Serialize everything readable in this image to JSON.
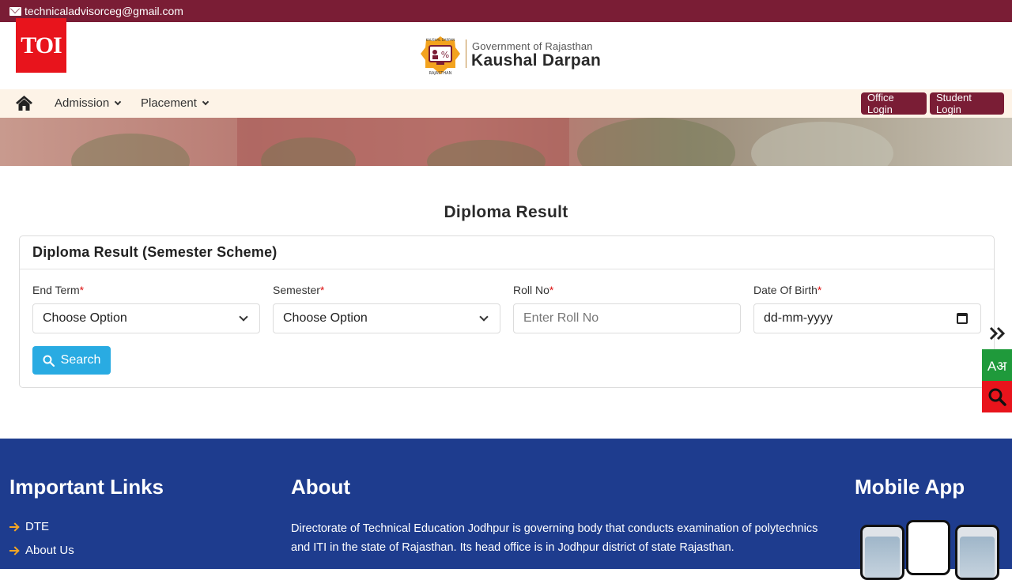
{
  "topbar": {
    "email": "technicaladvisorceg@gmail.com",
    "email_icon": "envelope-icon"
  },
  "watermark": {
    "text": "TOI"
  },
  "brand": {
    "logo_icon": "kaushal-darpan-emblem-icon",
    "logo_top_text": "KAUSHAL DARPAN",
    "logo_bottom_text": "RAJASTHAN",
    "government_text": "Government of Rajasthan",
    "title": "Kaushal Darpan"
  },
  "nav": {
    "home_icon": "home-icon",
    "items": [
      {
        "label": "Admission"
      },
      {
        "label": "Placement"
      }
    ],
    "office_login": "Office Login",
    "student_login": "Student Login"
  },
  "page": {
    "title": "Diploma Result"
  },
  "form": {
    "card_title": "Diploma Result (Semester Scheme)",
    "fields": [
      {
        "label": "End Term",
        "required": "*",
        "value": "Choose Option",
        "type": "select"
      },
      {
        "label": "Semester",
        "required": "*",
        "value": "Choose Option",
        "type": "select"
      },
      {
        "label": "Roll No",
        "required": "*",
        "placeholder": "Enter Roll No",
        "type": "text"
      },
      {
        "label": "Date Of Birth",
        "required": "*",
        "placeholder": "dd-mm-yyyy",
        "type": "date"
      }
    ],
    "search_label": "Search"
  },
  "side_tools": {
    "toggle_icon": "double-chevron-right-icon",
    "language_label": "Aअ",
    "search_icon": "search-icon"
  },
  "footer": {
    "links_title": "Important Links",
    "links": [
      "DTE",
      "About Us"
    ],
    "about_title": "About",
    "about_text": "Directorate of Technical Education Jodhpur is governing body that conducts examination of polytechnics and ITI in the state of Rajasthan. Its head office is in Jodhpur district of state Rajasthan.",
    "app_title": "Mobile App"
  },
  "colors": {
    "maroon": "#7a1d35",
    "nav_bg": "#fdf3e7",
    "accent_blue": "#29abe2",
    "footer_blue": "#1e3c8e",
    "green": "#1f9a3b",
    "red": "#e8141c",
    "arrow_orange": "#f5a623"
  }
}
